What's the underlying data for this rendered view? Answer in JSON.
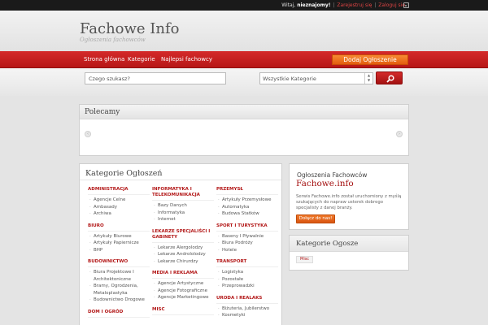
{
  "topbar": {
    "greeting": "Witaj,",
    "user": "nieznajomy!",
    "register": "Zarejestruj się",
    "login": "Zaloguj się",
    "separator": "|"
  },
  "header": {
    "title": "Fachowe Info",
    "tagline": "Ogłoszenia fachowców"
  },
  "nav": {
    "items": [
      "Strona główna",
      "Kategorie",
      "Najlepsi fachowcy"
    ],
    "add_button": "Dodaj Ogłoszenie"
  },
  "search": {
    "placeholder": "Czego szukasz?",
    "category_selected": "Wszystkie Kategorie"
  },
  "featured": {
    "title": "Polecamy"
  },
  "categories": {
    "title": "Kategorie Ogłoszeń",
    "columns": [
      [
        {
          "name": "ADMINISTRACJA",
          "subs": [
            "Agencje Celne",
            "Ambasady",
            "Archiwa"
          ]
        },
        {
          "name": "BIURO",
          "subs": [
            "Artykuły Biurowe",
            "Artykuły Papiernicze",
            "BHP"
          ]
        },
        {
          "name": "BUDOWNICTWO",
          "subs": [
            "Biura Projektowe I Architektoniczne",
            "Bramy, Ogrodzenia, Metaloplastyka",
            "Budownictwo Drogowe"
          ]
        },
        {
          "name": "DOM I OGRÓD",
          "subs": []
        }
      ],
      [
        {
          "name": "INFORMATYKA I TELEKOMUNIKACJA",
          "subs": [
            "Bazy Danych",
            "Informatyka",
            "Internet"
          ]
        },
        {
          "name": "LEKARZE SPECJALIŚCI I GABINETY",
          "subs": [
            "Lekarze Alergolodzy",
            "Lekarze Andrololodzy",
            "Lekarze Chirurdzy"
          ]
        },
        {
          "name": "MEDIA I REKLAMA",
          "subs": [
            "Agencje Artystyczne",
            "Agencje Fotograficzne",
            "Agencje Marketingowe"
          ]
        },
        {
          "name": "MISC",
          "subs": []
        }
      ],
      [
        {
          "name": "PRZEMYSŁ",
          "subs": [
            "Artykuły Przemysłowe",
            "Automatyka",
            "Budowa Statków"
          ]
        },
        {
          "name": "SPORT I TURYSTYKA",
          "subs": [
            "Baseny I Pływalnie",
            "Biura Podróży",
            "Hotele"
          ]
        },
        {
          "name": "TRANSPORT",
          "subs": [
            "Logistyka",
            "Pozostałe",
            "Przeprowadzki"
          ]
        },
        {
          "name": "URODA I REALAKS",
          "subs": [
            "Biżuteria, Jubilerstwo",
            "Kosmetyki"
          ]
        }
      ]
    ]
  },
  "info": {
    "title": "Ogłoszenia Fachowców",
    "brand": "Fachowe.info",
    "description": "Serwis Fachowe.info został uruchomiony z myślą szukających do napraw usterek dobrego specjalisty z danej branży.",
    "join_button": "Dołącz do nas!"
  },
  "sidebar_categories": {
    "title": "Kategorie Ogosze",
    "tags": [
      "Misc"
    ]
  },
  "colors": {
    "accent_red": "#c41e1e",
    "accent_orange": "#f07a2b",
    "topbar": "#1a1a1a"
  },
  "icons": {
    "rss": "rss-icon",
    "search": "search-icon"
  }
}
